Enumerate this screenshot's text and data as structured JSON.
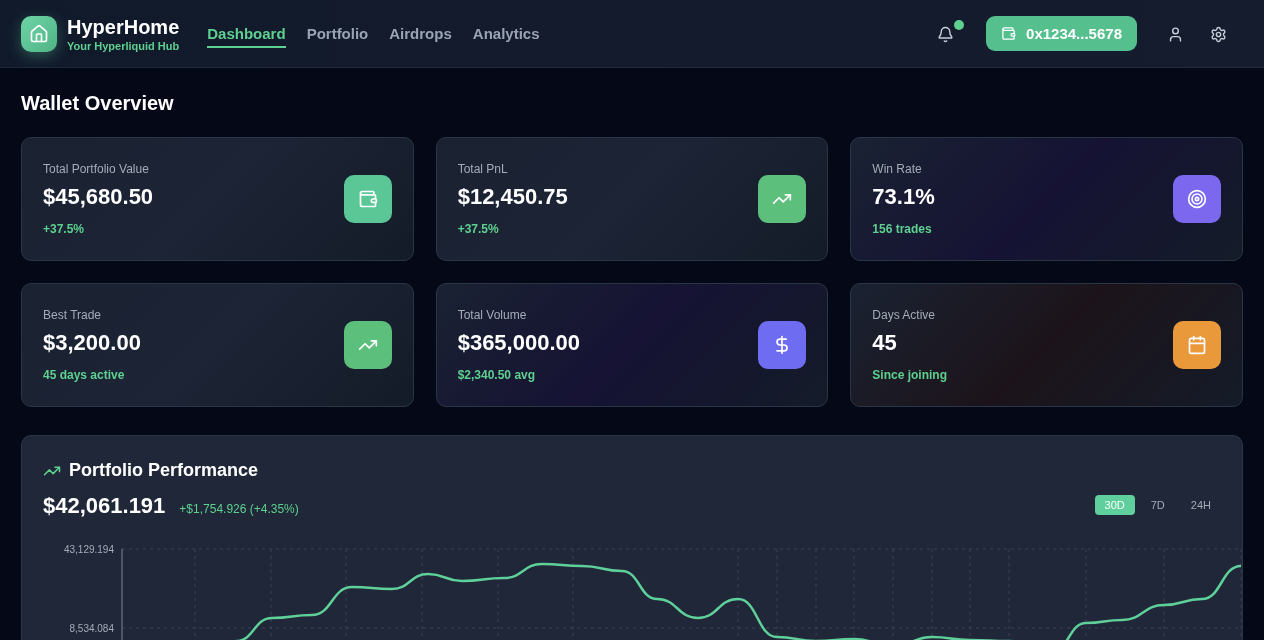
{
  "brand": {
    "name": "HyperHome",
    "tagline": "Your Hyperliquid Hub"
  },
  "nav": [
    {
      "label": "Dashboard",
      "selected": true
    },
    {
      "label": "Portfolio",
      "selected": false
    },
    {
      "label": "Airdrops",
      "selected": false
    },
    {
      "label": "Analytics",
      "selected": false
    }
  ],
  "notifications": {
    "unread": true
  },
  "wallet_button": {
    "label": "0x1234...5678"
  },
  "page_title": "Wallet Overview",
  "stats": [
    {
      "label": "Total Portfolio Value",
      "value": "$45,680.50",
      "note": "+37.5%",
      "kind": "wallet",
      "color": "#5cc796"
    },
    {
      "label": "Total PnL",
      "value": "$12,450.75",
      "note": "+37.5%",
      "kind": "trend",
      "color": "#5cbf7c"
    },
    {
      "label": "Win Rate",
      "value": "73.1%",
      "note": "156 trades",
      "kind": "target",
      "color": "#7b68ee"
    },
    {
      "label": "Best Trade",
      "value": "$3,200.00",
      "note": "45 days active",
      "kind": "trend",
      "color": "#5cbf7c"
    },
    {
      "label": "Total Volume",
      "value": "$365,000.00",
      "note": "$2,340.50 avg",
      "kind": "dollar",
      "color": "#6e6cf0"
    },
    {
      "label": "Days Active",
      "value": "45",
      "note": "Since joining",
      "kind": "calendar",
      "color": "#e9983a"
    }
  ],
  "performance": {
    "title": "Portfolio Performance",
    "value": "$42,061.191",
    "change": "+$1,754.926 (+4.35%)",
    "ranges": [
      {
        "label": "30D",
        "selected": true
      },
      {
        "label": "7D",
        "selected": false
      },
      {
        "label": "24H",
        "selected": false
      }
    ],
    "axis_labels": [
      "43,129.194",
      "8,534.084"
    ]
  }
}
